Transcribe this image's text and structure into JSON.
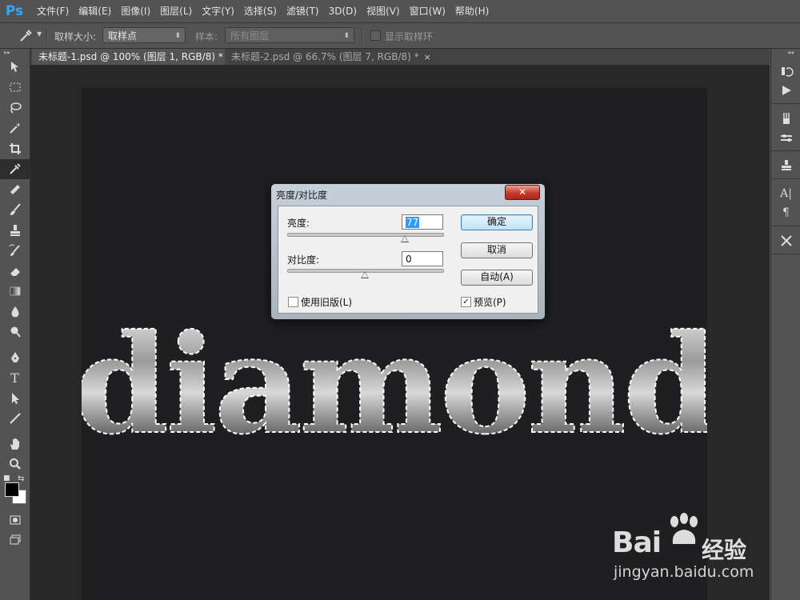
{
  "app": {
    "logo": "Ps"
  },
  "menubar": {
    "items": [
      "文件(F)",
      "编辑(E)",
      "图像(I)",
      "图层(L)",
      "文字(Y)",
      "选择(S)",
      "滤镜(T)",
      "3D(D)",
      "视图(V)",
      "窗口(W)",
      "帮助(H)"
    ]
  },
  "options": {
    "sample_size_label": "取样大小:",
    "sample_size_value": "取样点",
    "sample_label": "样本:",
    "sample_value": "所有图层",
    "show_ring_label": "显示取样环"
  },
  "tabs": [
    {
      "label": "未标题-1.psd @ 100% (图层 1, RGB/8) *",
      "close": "×"
    },
    {
      "label": "未标题-2.psd @ 66.7% (图层 7, RGB/8) *",
      "close": "×"
    }
  ],
  "canvas": {
    "art_text": "diamond"
  },
  "colors": {
    "foreground": "#000000",
    "background": "#ffffff",
    "accent": "#31a8ff"
  },
  "dialog": {
    "title": "亮度/对比度",
    "close_label": "✕",
    "brightness_label": "亮度:",
    "brightness_value": "77",
    "contrast_label": "对比度:",
    "contrast_value": "0",
    "ok_label": "确定",
    "cancel_label": "取消",
    "auto_label": "自动(A)",
    "legacy_label": "使用旧版(L)",
    "legacy_checked": false,
    "preview_label": "预览(P)",
    "preview_checked": true,
    "brightness_slider_fraction": 0.76,
    "contrast_slider_fraction": 0.5
  },
  "watermark": {
    "brand": "Bai",
    "brand2": "经验",
    "url": "jingyan.baidu.com"
  }
}
